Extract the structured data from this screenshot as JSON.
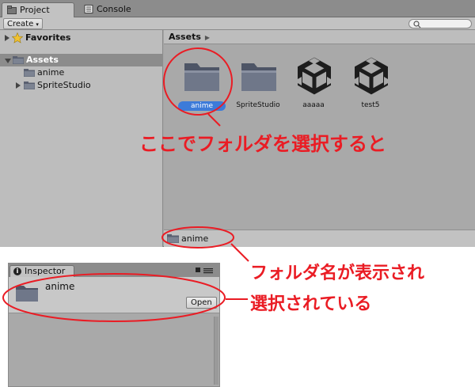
{
  "project": {
    "tabs": [
      {
        "label": "Project",
        "active": true
      },
      {
        "label": "Console",
        "active": false
      }
    ],
    "create_label": "Create",
    "tree": [
      {
        "label": "Favorites",
        "bold": true,
        "icon": "star-icon",
        "expanded": false
      },
      {
        "label": "Assets",
        "bold": true,
        "icon": "folder-icon",
        "expanded": true,
        "selected": true
      },
      {
        "label": "anime",
        "icon": "folder-icon"
      },
      {
        "label": "SpriteStudio",
        "icon": "folder-icon",
        "expanded": false
      }
    ],
    "breadcrumb": "Assets",
    "assets": [
      {
        "label": "anime",
        "icon": "folder-icon",
        "selected": true
      },
      {
        "label": "SpriteStudio",
        "icon": "folder-icon",
        "selected": false
      },
      {
        "label": "aaaaa",
        "icon": "unity-logo-icon",
        "selected": false
      },
      {
        "label": "test5",
        "icon": "unity-logo-icon",
        "selected": false
      }
    ],
    "status_label": "anime"
  },
  "inspector": {
    "tab_label": "Inspector",
    "name": "anime",
    "open_label": "Open"
  },
  "annotations": {
    "select_folder": "ここでフォルダを選択すると",
    "name_shown_line1": "フォルダ名が表示され",
    "name_shown_line2": "選択されている",
    "color": "#ea1c24"
  }
}
